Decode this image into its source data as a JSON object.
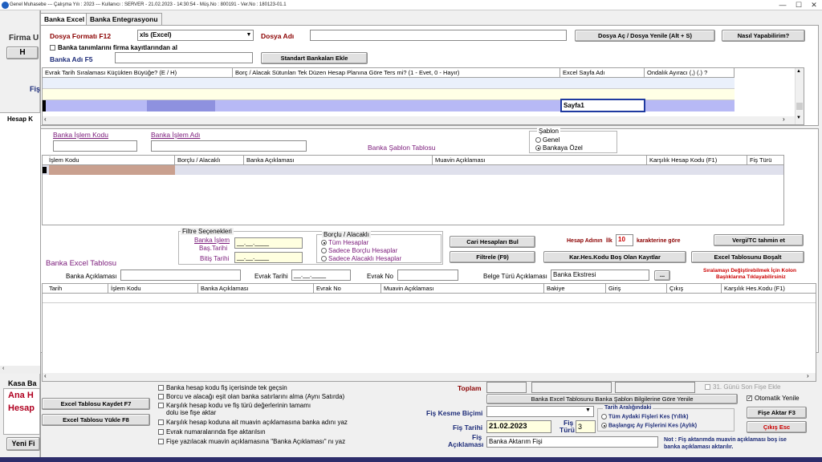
{
  "window": {
    "title": "Genel Muhasebe  ---  Çalışma Yılı : 2023   ---  Kullanıcı : SERVER - 21.02.2023 - 14:30:54 - Müş.No : 800191 - Ver.No : 180123-01.1"
  },
  "background": {
    "firma_label": "Firma U",
    "button_h": "H",
    "fis_label": "Fiş",
    "hesap_col": "Hesap K",
    "kasa_label": "Kasa Ba",
    "ana_label": "Ana H",
    "hesap_label": "Hesap",
    "yeni_button": "Yeni Fi"
  },
  "tabs": [
    {
      "label": "Banka Excel"
    },
    {
      "label": "Banka Entegrasyonu"
    }
  ],
  "top": {
    "format_label": "Dosya Formatı F12",
    "format_value": "xls (Excel)",
    "dosya_adi_label": "Dosya Adı",
    "dosya_adi_value": "",
    "open_button": "Dosya Aç / Dosya Yenile (Alt + S)",
    "howto_button": "Nasıl Yapabilirim?",
    "firma_checkbox": "Banka tanımlarını firma kayıtlarından al",
    "banka_adi_label": "Banka Adı F5",
    "banka_adi_value": "",
    "standart_button": "Standart Bankaları Ekle"
  },
  "settings_grid": {
    "columns": [
      "Evrak Tarih Sıralaması Küçükten Büyüğe? (E / H)",
      "Borç / Alacak Sütunları Tek Düzen Hesap Planına Göre Ters mi? (1 - Evet, 0 - Hayır)",
      "Excel Sayfa Adı",
      "Ondalık Ayıracı (,) (.) ?"
    ],
    "sheet_value": "Sayfa1"
  },
  "islem": {
    "kod_label": "Banka İşlem Kodu",
    "ad_label": "Banka İşlem Adı",
    "sablon_table_label": "Banka Şablon Tablosu",
    "sablon_group": "Şablon",
    "sablon_genel": "Genel",
    "sablon_ozel": "Bankaya Özel"
  },
  "sablon_grid": {
    "columns": [
      "İşlem Kodu",
      "Borçlu / Alacaklı",
      "Banka Açıklaması",
      "Muavin Açıklaması",
      "Karşılık Hesap Kodu (F1)",
      "Fiş Türü"
    ]
  },
  "filter": {
    "group_label": "Filtre Seçenekleri",
    "bas_label1": "Banka İşlem",
    "bas_label2": "Baş.Tarihi",
    "bitis_label": "Bitiş Tarihi",
    "date_placeholder": "__.__.____",
    "borclu_group": "Borçlu / Alacaklı",
    "opt_all": "Tüm Hesaplar",
    "opt_borclu": "Sadece Borçlu Hesaplar",
    "opt_alacakli": "Sadece Alacaklı Hesaplar",
    "cari_button": "Cari Hesapları Bul",
    "filtrele_button": "Filtrele (F9)",
    "hesap_adinin": "Hesap Adının",
    "ilk": "İlk",
    "ilk_value": "10",
    "karakter": "karakterine göre",
    "karhes_button": "Kar.Hes.Kodu Boş Olan Kayıtlar",
    "vergi_button": "Vergi/TC tahmin et",
    "bosalt_button": "Excel Tablosunu Boşalt"
  },
  "excel_table": {
    "title": "Banka Excel Tablosu",
    "aciklama_label": "Banka Açıklaması",
    "evrak_tarihi_label": "Evrak Tarihi",
    "evrak_tarihi_value": "__.__.____",
    "evrak_no_label": "Evrak No",
    "belge_turu_label": "Belge Türü Açıklaması",
    "belge_turu_value": "Banka Ekstresi",
    "ellipsis": "...",
    "note1": "Sıralamayı Değiştirebilmek İçin Kolon",
    "note2": "Başlıklarına Tıklayabilirsiniz",
    "columns": [
      "Tarih",
      "İşlem Kodu",
      "Banka Açıklaması",
      "Evrak No",
      "Muavin Açıklaması",
      "Bakiye",
      "Giriş",
      "Çıkış",
      "Karşılık Hes.Kodu (F1)"
    ]
  },
  "bottom": {
    "kaydet_button": "Excel Tablosu Kaydet F7",
    "yukle_button": "Excel Tablosu Yükle F8",
    "options": [
      "Banka hesap kodu fiş içerisinde tek geçsin",
      "Borcu ve alacağı eşit olan banka satırlarını alma (Aynı Satırda)",
      "Karşılık hesap kodu ve fiş türü değerlerinin tamamı",
      "dolu ise fişe aktar",
      "Karşılık hesap koduna ait muavin açıklamasına banka adını yaz",
      "Evrak numaralarında fişe aktarılsın",
      "Fişe yazılacak muavin açıklamasına \"Banka Açıklaması\" nı yaz"
    ],
    "toplam_label": "Toplam",
    "son_fise": "31. Günü Son Fişe Ekle",
    "sablon_refresh_button": "Banka Excel Tablosunu Banka Şablon Bilgilerine Göre Yenile",
    "otomatik": "Otomatik Yenile",
    "kesme_label": "Fiş Kesme Biçimi",
    "tarih_group": "Tarih Aralığındaki",
    "tarih_opt1": "Tüm Aydaki Fişleri Kes (Yıllık)",
    "tarih_opt2": "Başlangıç Ay Fişlerini Kes (Aylık)",
    "fise_aktar_button": "Fişe Aktar F3",
    "cikis_button": "Çıkış Esc",
    "fis_tarihi_label": "Fiş Tarihi",
    "fis_tarihi_value": "21.02.2023",
    "fis_turu_label1": "Fiş",
    "fis_turu_label2": "Türü",
    "fis_turu_value": "3",
    "fis_aciklama_label1": "Fiş",
    "fis_aciklama_label2": "Açıklaması",
    "fis_aciklama_value": "Banka Aktarım Fişi",
    "note1": "Not : Fiş aktarımda muavin açıklaması boş ise",
    "note2": "banka açıklaması aktarılır."
  }
}
